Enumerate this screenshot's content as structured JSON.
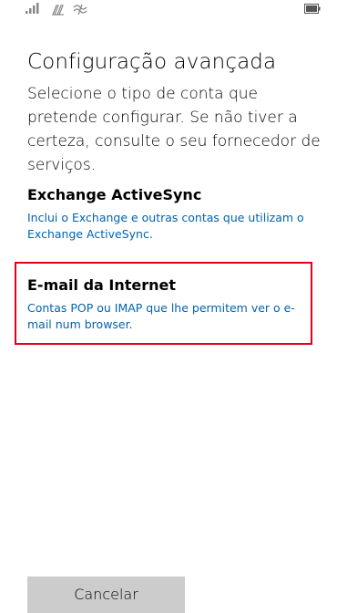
{
  "status_bar": {
    "icons": [
      "signal-strength-icon",
      "wifi-icon",
      "cellular-data-icon",
      "battery-icon"
    ]
  },
  "header": {
    "title": "Configuração avançada",
    "description": "Selecione o tipo de conta que pretende configurar. Se não tiver a certeza, consulte o seu fornecedor de serviços."
  },
  "options": [
    {
      "title": "Exchange ActiveSync",
      "description": "Inclui o Exchange e outras contas que utilizam o Exchange ActiveSync."
    },
    {
      "title": "E-mail da Internet",
      "description": "Contas POP ou IMAP que lhe permitem ver o e-mail num browser.",
      "highlighted": true
    }
  ],
  "footer": {
    "cancel_label": "Cancelar"
  },
  "colors": {
    "link": "#0063b1",
    "highlight_border": "#e3001b",
    "button_bg": "#cccccc"
  }
}
